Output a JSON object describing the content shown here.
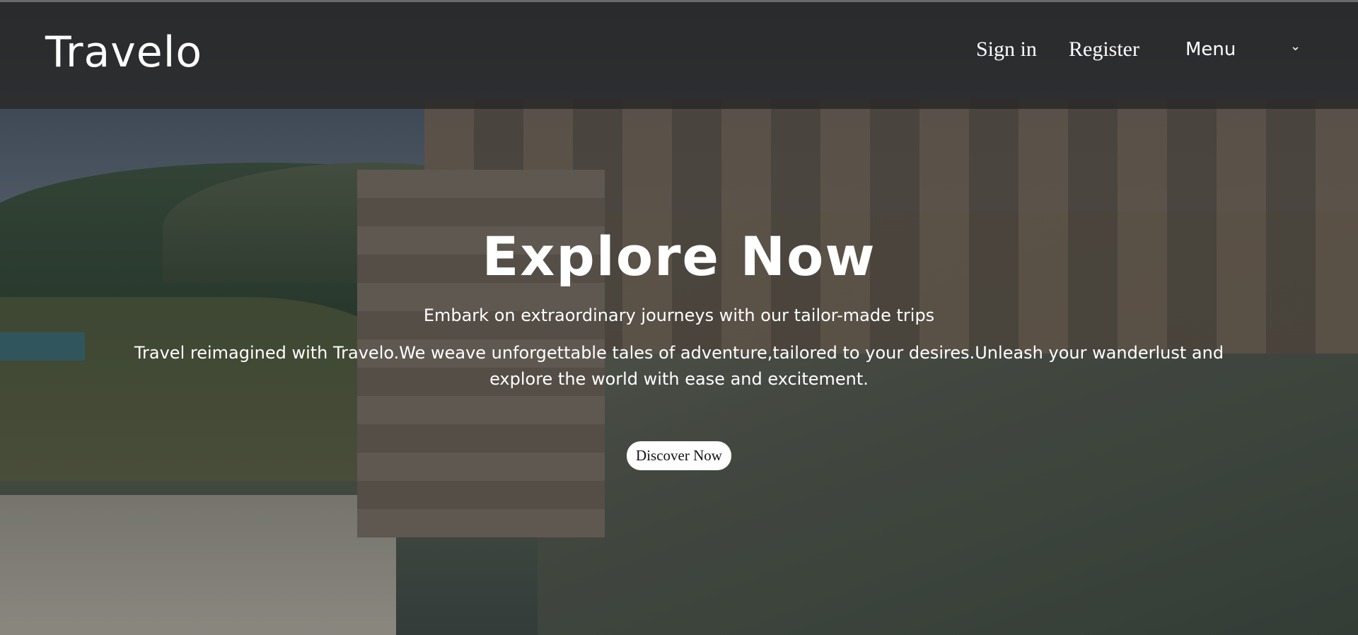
{
  "navbar": {
    "brand": "Travelo",
    "sign_in": "Sign in",
    "register": "Register",
    "menu_label": "Menu",
    "menu_icon": "chevron-down-icon"
  },
  "hero": {
    "title": "Explore Now",
    "tagline": "Embark on extraordinary journeys with our tailor-made trips",
    "description": "Travel reimagined with Travelo.We weave unforgettable tales of adventure,tailored to your desires.Unleash your wanderlust and explore the world with ease and excitement.",
    "cta_label": "Discover Now",
    "background": "coastal-cliff-town-photo"
  },
  "colors": {
    "navbar_bg": "#282828",
    "text": "#ffffff",
    "cta_bg": "#ffffff",
    "cta_text": "#111111"
  }
}
